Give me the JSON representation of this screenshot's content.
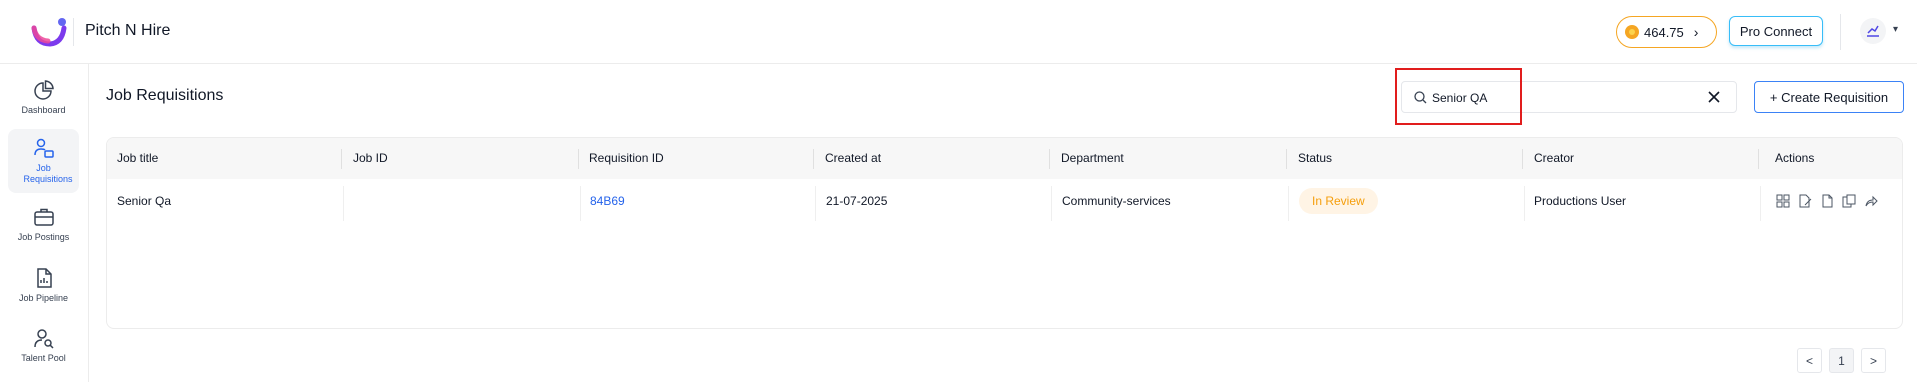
{
  "app": {
    "brand": "Pitch N Hire"
  },
  "header": {
    "credits": "464.75",
    "pro_connect_label": "Pro Connect"
  },
  "sidebar": {
    "items": [
      {
        "label": "Dashboard",
        "icon": "pie-chart-icon",
        "active": false
      },
      {
        "label": "Job Requisitions",
        "icon": "user-list-icon",
        "active": true
      },
      {
        "label": "Job Postings",
        "icon": "briefcase-icon",
        "active": false
      },
      {
        "label": "Job Pipeline",
        "icon": "document-chart-icon",
        "active": false
      },
      {
        "label": "Talent Pool",
        "icon": "user-search-icon",
        "active": false
      }
    ]
  },
  "main": {
    "title": "Job Requisitions",
    "search": {
      "value": "Senior QA",
      "icon": "search-icon"
    },
    "create_label": "+ Create Requisition"
  },
  "table": {
    "columns": [
      "Job title",
      "Job ID",
      "Requisition ID",
      "Created at",
      "Department",
      "Status",
      "Creator",
      "Actions"
    ],
    "rows": [
      {
        "job_title": "Senior Qa",
        "job_id": "",
        "requisition_id": "84B69",
        "created_at": "21-07-2025",
        "department": "Community-services",
        "status": "In Review",
        "creator": "Productions User",
        "actions": [
          "view-grid-icon",
          "edit-icon",
          "copy-icon",
          "duplicate-icon",
          "share-icon"
        ]
      }
    ]
  },
  "pagination": {
    "prev": "<",
    "current": "1",
    "next": ">"
  },
  "colors": {
    "accent": "#2563eb",
    "status_review": "#f59e0b",
    "credits_border": "#f5a623",
    "highlight": "#e11d1d"
  }
}
